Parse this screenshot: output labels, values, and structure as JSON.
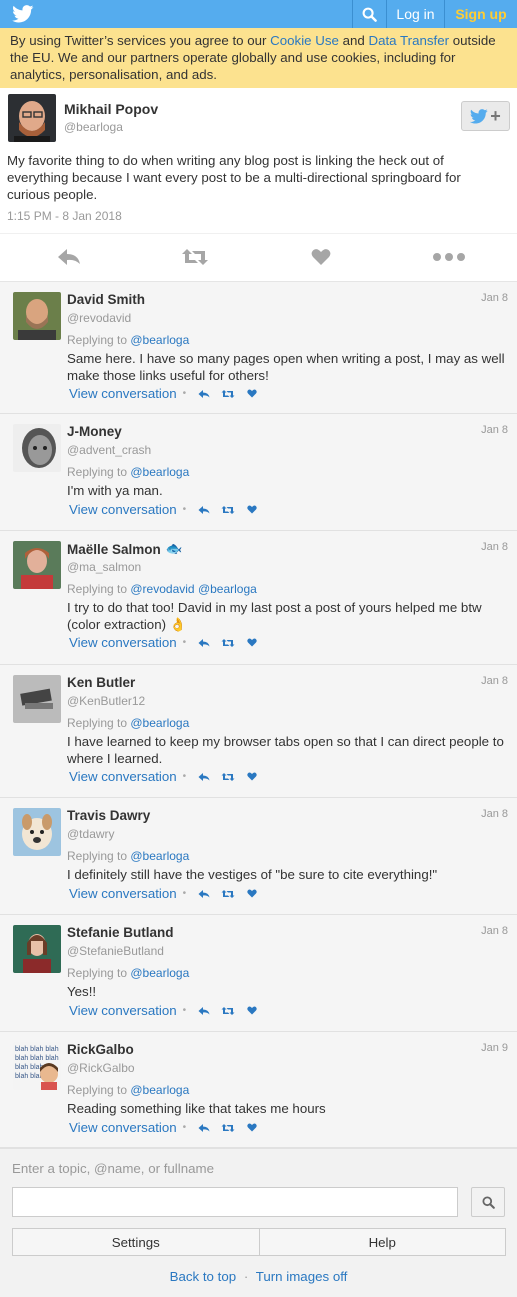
{
  "topbar": {
    "login": "Log in",
    "signup": "Sign up"
  },
  "cookie": {
    "part1": "By using Twitter’s services you agree to our ",
    "link1": "Cookie Use",
    "part2": " and ",
    "link2": "Data Transfer",
    "part3": " outside the EU. We and our partners operate globally and use cookies, including for analytics, personalisation, and ads."
  },
  "tweet": {
    "name": "Mikhail Popov",
    "handle": "@bearloga",
    "text": "My favorite thing to do when writing any blog post is linking the heck out of everything because I want every post to be a multi-directional springboard for curious people.",
    "time": "1:15 PM - 8 Jan 2018"
  },
  "replying_label": "Replying to ",
  "view_conversation": "View conversation",
  "replies": [
    {
      "name": "David Smith",
      "handle": "@revodavid",
      "date": "Jan 8",
      "to": [
        "@bearloga"
      ],
      "text": "Same here. I have so many pages open when writing a post, I may as well make those links useful for others!",
      "emoji": ""
    },
    {
      "name": "J-Money",
      "handle": "@advent_crash",
      "date": "Jan 8",
      "to": [
        "@bearloga"
      ],
      "text": "I'm with ya man.",
      "emoji": ""
    },
    {
      "name": "Maëlle Salmon",
      "handle": "@ma_salmon",
      "date": "Jan 8",
      "to": [
        "@revodavid",
        "@bearloga"
      ],
      "text": "I try to do that too! David in my last post a post of yours helped me btw (color extraction) 👌",
      "emoji": "🐟"
    },
    {
      "name": "Ken Butler",
      "handle": "@KenButler12",
      "date": "Jan 8",
      "to": [
        "@bearloga"
      ],
      "text": "I have learned to keep my browser tabs open so that I can direct people to where I learned.",
      "emoji": ""
    },
    {
      "name": "Travis Dawry",
      "handle": "@tdawry",
      "date": "Jan 8",
      "to": [
        "@bearloga"
      ],
      "text": "I definitely still have the vestiges of \"be sure to cite everything!\"",
      "emoji": ""
    },
    {
      "name": "Stefanie Butland",
      "handle": "@StefanieButland",
      "date": "Jan 8",
      "to": [
        "@bearloga"
      ],
      "text": "Yes!!",
      "emoji": ""
    },
    {
      "name": "RickGalbo",
      "handle": "@RickGalbo",
      "date": "Jan 9",
      "to": [
        "@bearloga"
      ],
      "text": "Reading something like that takes me hours",
      "emoji": ""
    }
  ],
  "footer": {
    "search_hint": "Enter a topic, @name, or fullname",
    "settings": "Settings",
    "help": "Help",
    "back_to_top": "Back to top",
    "separator": "·",
    "images_off": "Turn images off"
  },
  "colors": {
    "topbar": "#55acee",
    "cookie_bg": "#fce28f",
    "link": "#2a78c1",
    "signup": "#ffcd33"
  }
}
